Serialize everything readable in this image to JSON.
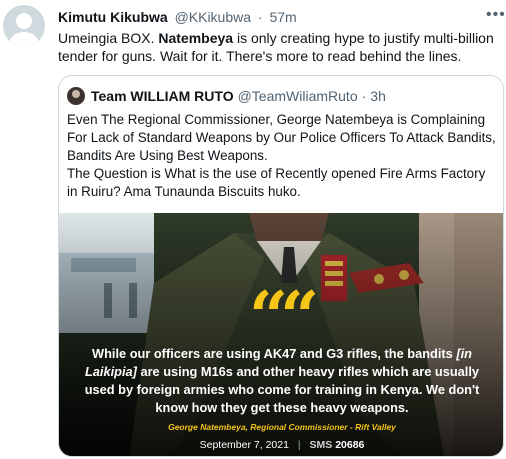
{
  "tweet": {
    "name": "Kimutu Kikubwa",
    "handle": "@KKikubwa",
    "sep": "·",
    "time": "57m",
    "more_icon": "more-horizontal-icon",
    "text_before": "Umeingia BOX. ",
    "text_bold": "Natembeya",
    "text_after": " is only creating hype to justify multi-billion tender for guns. Wait for it. There's more to read behind the lines."
  },
  "quoted": {
    "name": "Team WILLIAM RUTO",
    "handle": "@TeamWiliamRuto",
    "sep": "·",
    "time": "3h",
    "text": "Even The Regional Commissioner, George Natembeya is Complaining For Lack of Standard Weapons by Our Police Officers To Attack Bandits, Bandits Are Using Best Weapons.\nThe Question is What is the use of Recently opened Fire Arms Factory in Ruiru? Ama Tunaunda Biscuits huko."
  },
  "media": {
    "quote_mark": "““",
    "quote_line1a": "While our officers are using AK47 and G3 rifles, the bandits ",
    "quote_line1b": "[in",
    "quote_line2a": "Laikipia]",
    "quote_line2b": " are using M16s and other heavy rifles which are usually",
    "quote_line3": "used by foreign armies who come for training in Kenya. We don't",
    "quote_line4": "know how they get these heavy weapons.",
    "attribution": "George Natembeya, Regional Commissioner - Rift Valley",
    "date": "September 7, 2021",
    "brand_light": "SMS",
    "brand_bold": "20686",
    "accent": "#f5c518"
  }
}
